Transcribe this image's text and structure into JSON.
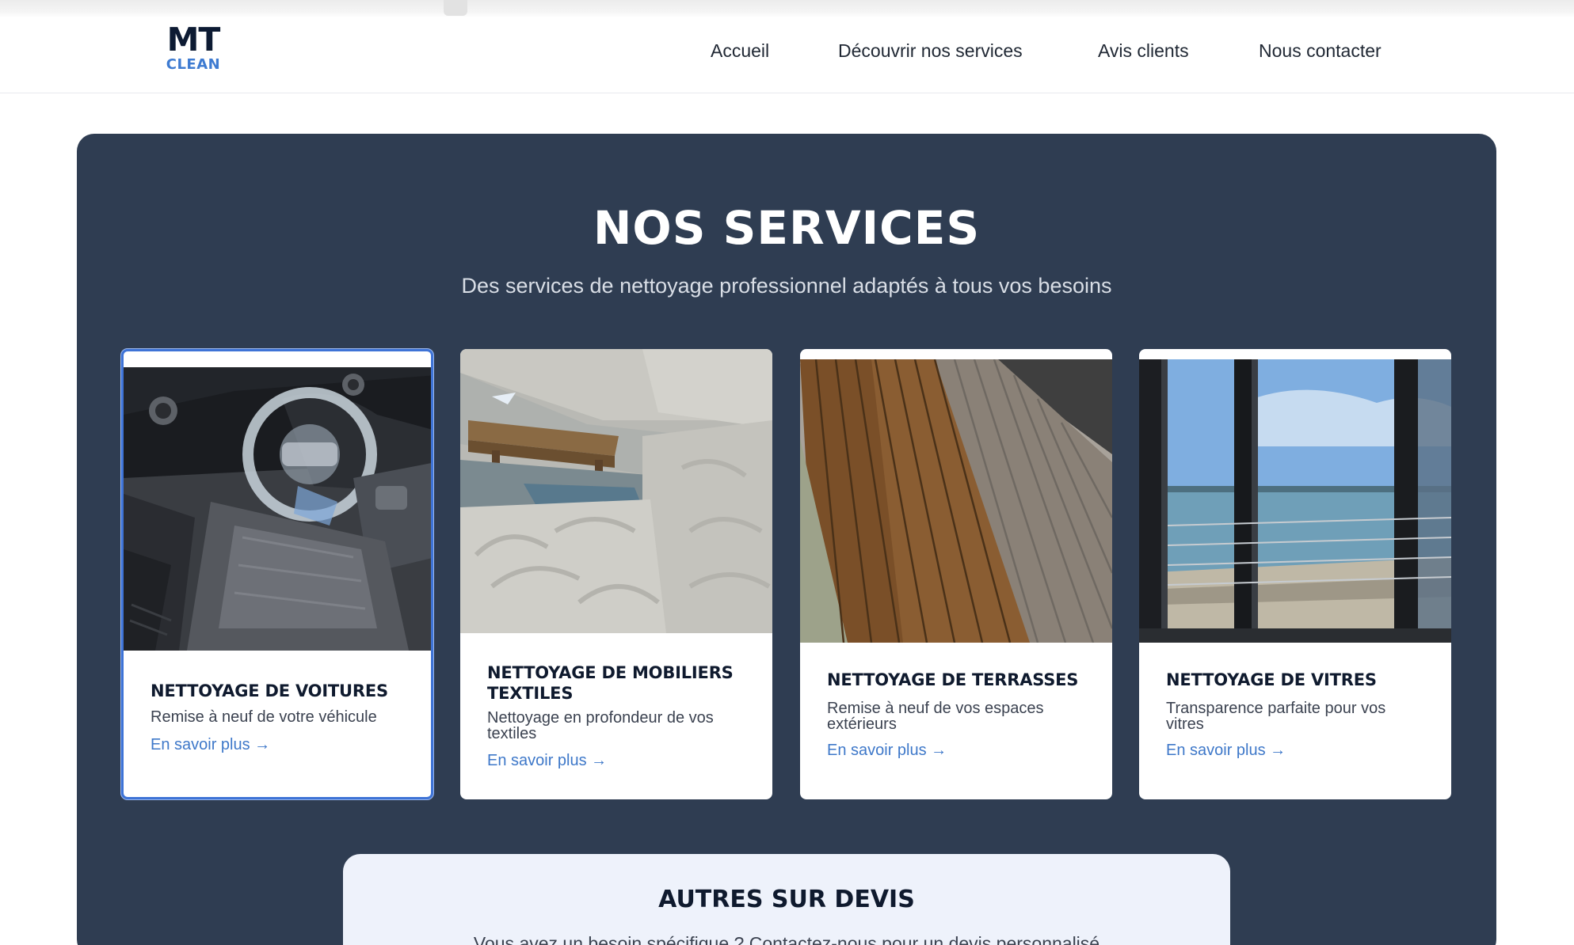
{
  "brand": {
    "line1": "MT",
    "line2": "CLEAN"
  },
  "nav": {
    "items": [
      {
        "label": "Accueil"
      },
      {
        "label": "Découvrir nos services"
      },
      {
        "label": "Avis clients"
      },
      {
        "label": "Nous contacter"
      }
    ]
  },
  "services": {
    "title": "NOS SERVICES",
    "subtitle": "Des services de nettoyage professionnel adaptés à tous vos besoins",
    "cards": [
      {
        "title": "NETTOYAGE DE VOITURES",
        "description": "Remise à neuf de votre véhicule",
        "link": "En savoir plus →",
        "image_icon": "car-interior-photo",
        "selected": true
      },
      {
        "title": "NETTOYAGE DE MOBILIERS TEXTILES",
        "description": "Nettoyage en profondeur de vos textiles",
        "link": "En savoir plus →",
        "image_icon": "sofa-rug-photo",
        "selected": false
      },
      {
        "title": "NETTOYAGE DE TERRASSES",
        "description": "Remise à neuf de vos espaces extérieurs",
        "link": "En savoir plus →",
        "image_icon": "wooden-deck-photo",
        "selected": false
      },
      {
        "title": "NETTOYAGE DE VITRES",
        "description": "Transparence parfaite pour vos vitres",
        "link": "En savoir plus →",
        "image_icon": "window-sea-view-photo",
        "selected": false
      }
    ]
  },
  "quote": {
    "title": "AUTRES SUR DEVIS",
    "description": "Vous avez un besoin spécifique ? Contactez-nous pour un devis personnalisé"
  },
  "colors": {
    "section_bg": "#2f3d52",
    "accent_blue": "#3e78c9",
    "brand_navy": "#0d1b33",
    "quote_bg": "#eef2fb"
  }
}
